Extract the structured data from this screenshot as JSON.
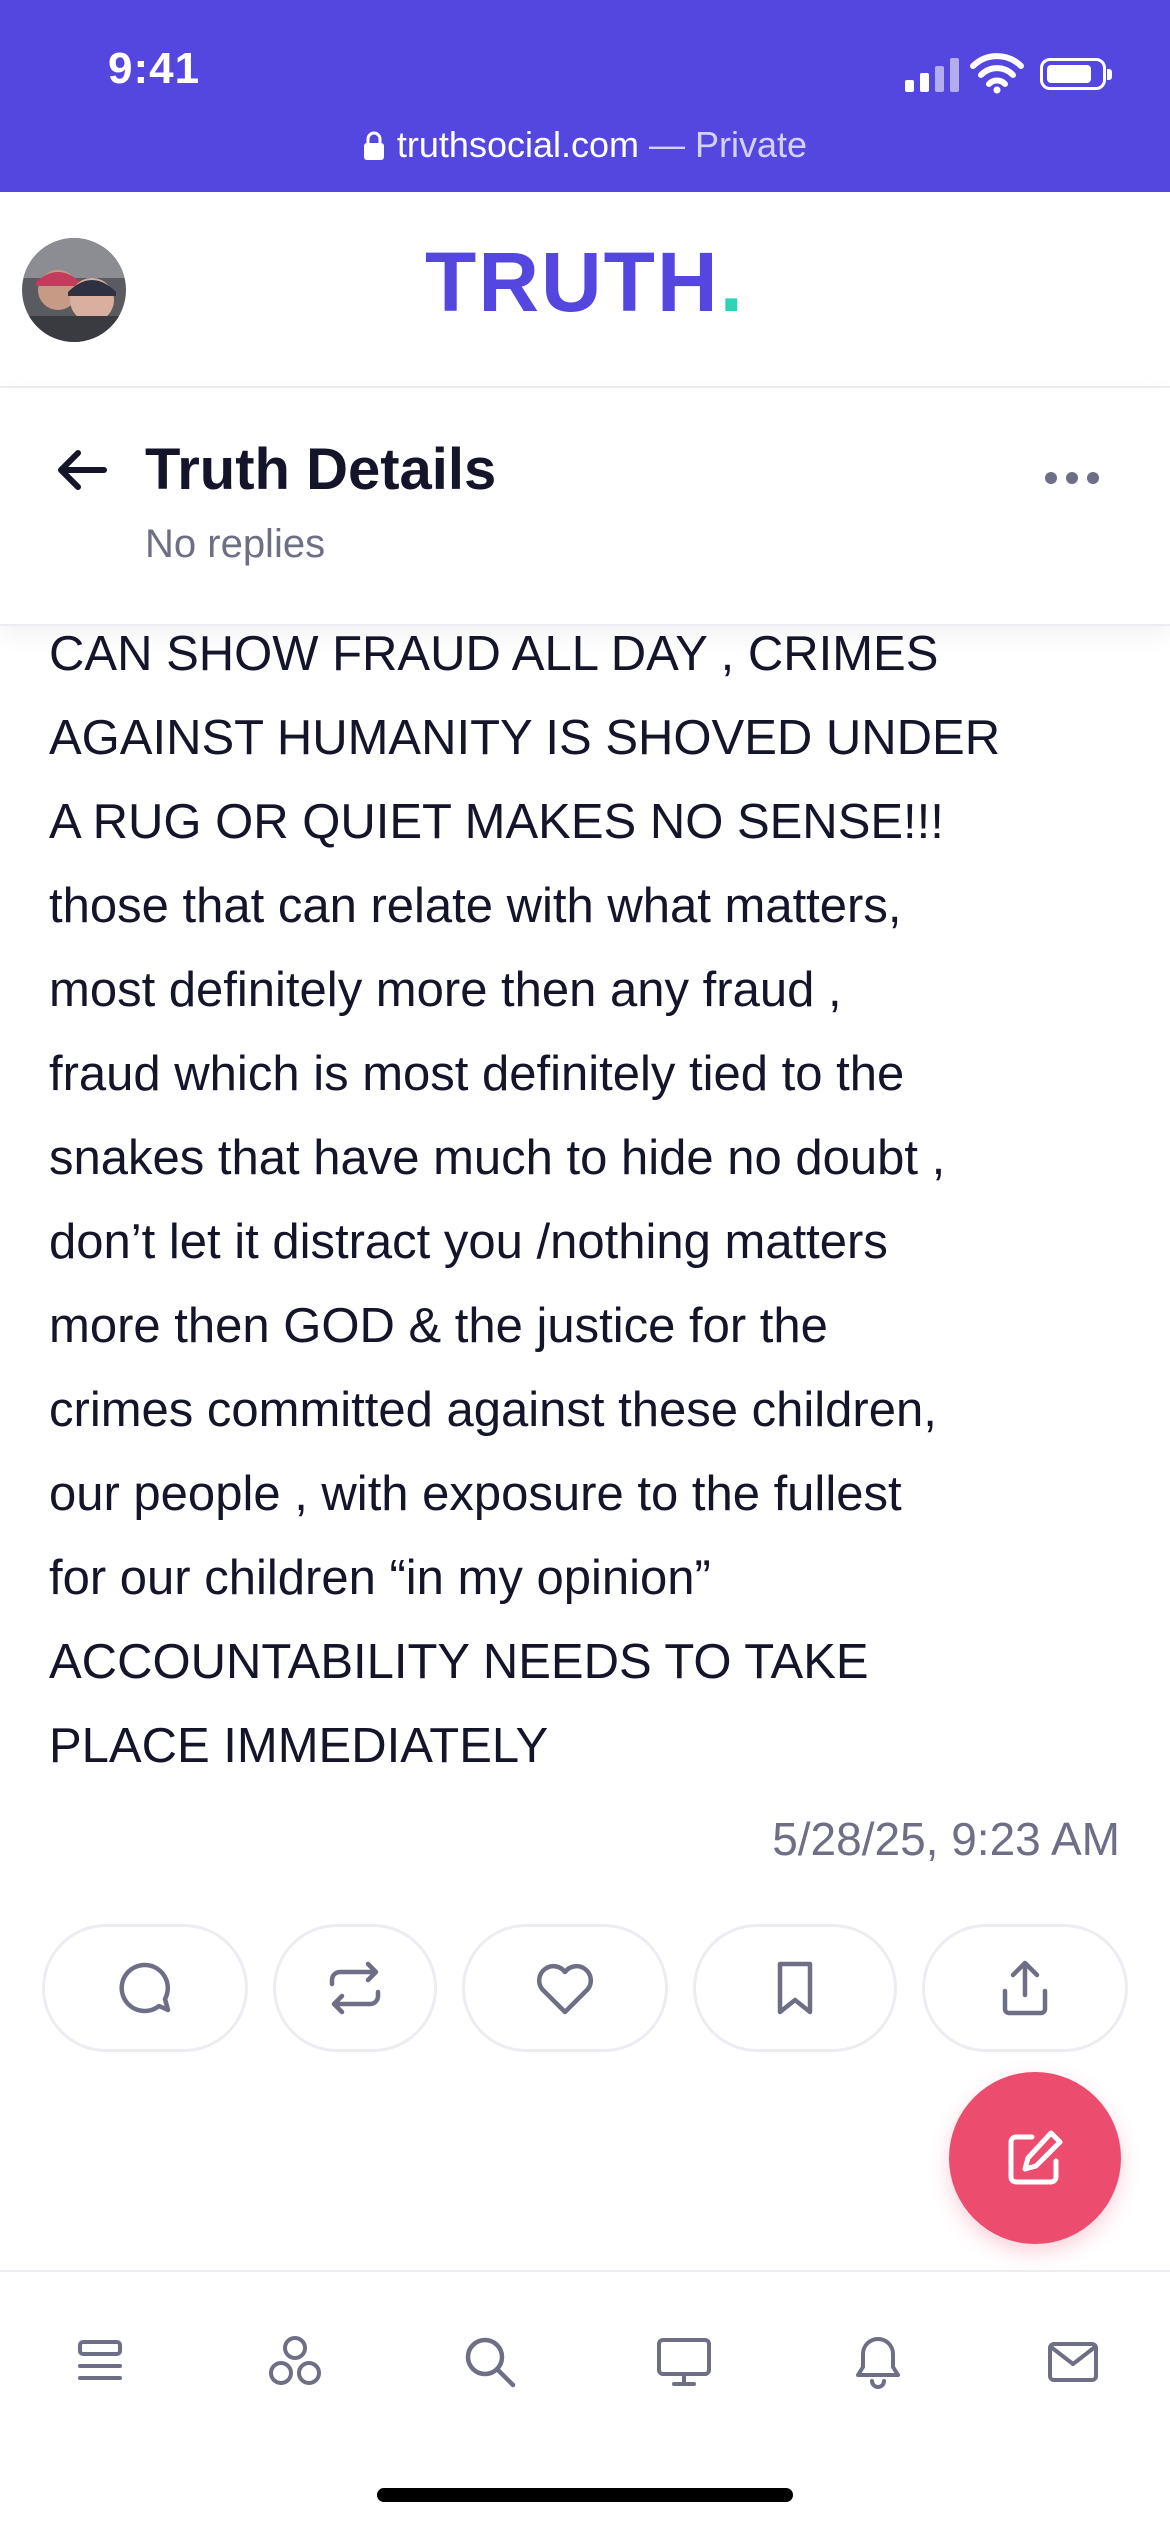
{
  "status_bar": {
    "time": "9:41",
    "url": "truthsocial.com",
    "url_suffix": " — Private"
  },
  "header": {
    "logo_text": "TRUTH",
    "logo_dot": ".",
    "avatar_alt": "profile-avatar"
  },
  "detail": {
    "title": "Truth Details",
    "subtitle": "No replies"
  },
  "post": {
    "lines": [
      "CAN SHOW FRAUD ALL DAY , CRIMES",
      "AGAINST HUMANITY IS SHOVED UNDER",
      "A RUG OR QUIET MAKES NO SENSE!!!",
      "those that can relate with what matters,",
      "most definitely more then any fraud ,",
      "fraud which is most definitely tied to the",
      "snakes that have much to hide no doubt ,",
      "don’t let it distract you /nothing matters",
      "more then GOD & the justice for the",
      "crimes committed against these children,",
      "our people , with exposure to the fullest",
      "for our children “in my opinion”",
      "ACCOUNTABILITY NEEDS TO TAKE",
      "PLACE IMMEDIATELY"
    ],
    "timestamp": "5/28/25, 9:23 AM"
  },
  "actions": [
    "reply-icon",
    "retruth-icon",
    "like-icon",
    "bookmark-icon",
    "share-icon"
  ],
  "fab": "compose-icon",
  "tabbar": [
    "feed-icon",
    "groups-icon",
    "search-icon",
    "tv-icon",
    "notifications-icon",
    "messages-icon"
  ],
  "colors": {
    "brand": "#5447e0",
    "accent_dot": "#2bd4b4",
    "fab": "#ec4c6e",
    "text": "#14142b",
    "muted": "#6e6e86"
  }
}
